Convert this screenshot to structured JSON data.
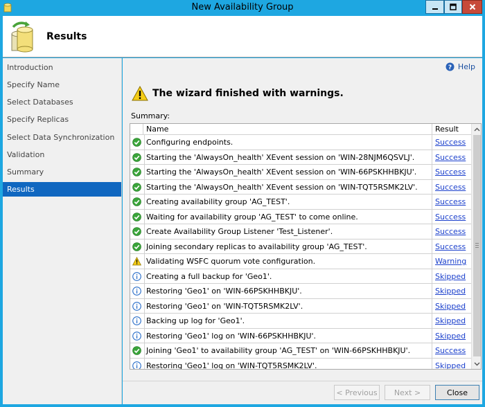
{
  "window": {
    "title": "New Availability Group"
  },
  "header": {
    "title": "Results"
  },
  "nav": {
    "items": [
      {
        "label": "Introduction"
      },
      {
        "label": "Specify Name"
      },
      {
        "label": "Select Databases"
      },
      {
        "label": "Specify Replicas"
      },
      {
        "label": "Select Data Synchronization"
      },
      {
        "label": "Validation"
      },
      {
        "label": "Summary"
      },
      {
        "label": "Results",
        "active": true
      }
    ]
  },
  "help": {
    "label": "Help"
  },
  "status": {
    "message": "The wizard finished with warnings.",
    "icon": "warning-icon"
  },
  "summary": {
    "label": "Summary:",
    "columns": {
      "name": "Name",
      "result": "Result"
    },
    "rows": [
      {
        "status": "success",
        "name": "Configuring endpoints.",
        "result": "Success"
      },
      {
        "status": "success",
        "name": "Starting the 'AlwaysOn_health' XEvent session on 'WIN-28NJM6QSVLJ'.",
        "result": "Success"
      },
      {
        "status": "success",
        "name": "Starting the 'AlwaysOn_health' XEvent session on 'WIN-66PSKHHBKJU'.",
        "result": "Success"
      },
      {
        "status": "success",
        "name": "Starting the 'AlwaysOn_health' XEvent session on 'WIN-TQT5RSMK2LV'.",
        "result": "Success"
      },
      {
        "status": "success",
        "name": "Creating availability group 'AG_TEST'.",
        "result": "Success"
      },
      {
        "status": "success",
        "name": "Waiting for availability group 'AG_TEST' to come online.",
        "result": "Success"
      },
      {
        "status": "success",
        "name": "Create Availability Group Listener 'Test_Listener'.",
        "result": "Success"
      },
      {
        "status": "success",
        "name": "Joining secondary replicas to availability group 'AG_TEST'.",
        "result": "Success"
      },
      {
        "status": "warning",
        "name": "Validating WSFC quorum vote configuration.",
        "result": "Warning"
      },
      {
        "status": "info",
        "name": "Creating a full backup for 'Geo1'.",
        "result": "Skipped"
      },
      {
        "status": "info",
        "name": "Restoring 'Geo1' on 'WIN-66PSKHHBKJU'.",
        "result": "Skipped"
      },
      {
        "status": "info",
        "name": "Restoring 'Geo1' on 'WIN-TQT5RSMK2LV'.",
        "result": "Skipped"
      },
      {
        "status": "info",
        "name": "Backing up log for 'Geo1'.",
        "result": "Skipped"
      },
      {
        "status": "info",
        "name": "Restoring 'Geo1' log on 'WIN-66PSKHHBKJU'.",
        "result": "Skipped"
      },
      {
        "status": "success",
        "name": "Joining 'Geo1' to availability group 'AG_TEST' on 'WIN-66PSKHHBKJU'.",
        "result": "Success"
      },
      {
        "status": "info",
        "name": "Restoring 'Geo1' log on 'WIN-TQT5RSMK2LV'.",
        "result": "Skipped"
      }
    ]
  },
  "buttons": {
    "previous": "< Previous",
    "next": "Next >",
    "close": "Close"
  },
  "colors": {
    "titlebar": "#1ea7e1",
    "nav_active": "#1067c0",
    "link": "#1a3fcc",
    "success": "#3aa43a",
    "warning": "#f2c811",
    "info": "#2b6fc9"
  }
}
